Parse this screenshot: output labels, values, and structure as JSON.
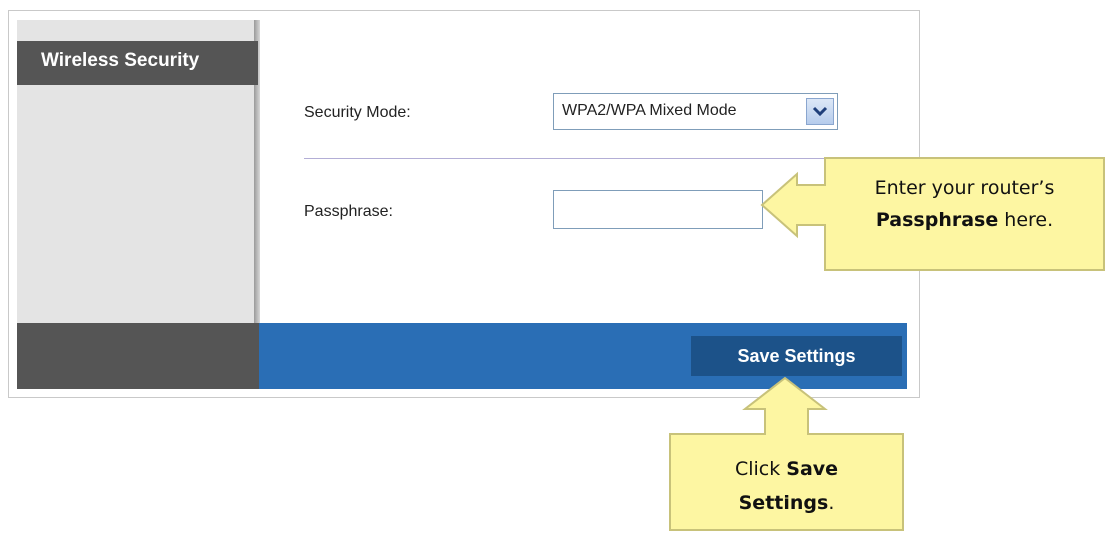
{
  "sidebar": {
    "title": "Wireless Security"
  },
  "form": {
    "security_mode_label": "Security Mode:",
    "security_mode_value": "WPA2/WPA Mixed Mode",
    "passphrase_label": "Passphrase:",
    "passphrase_value": ""
  },
  "footer": {
    "save_label": "Save Settings"
  },
  "callouts": {
    "passphrase": {
      "line1": "Enter your router’s",
      "bold": "Passphrase",
      "after": " here."
    },
    "save": {
      "before": "Click ",
      "bold1": "Save",
      "bold2": "Settings",
      "after": "."
    }
  },
  "colors": {
    "header_gray": "#555555",
    "sidebar_bg": "#e4e4e4",
    "footer_blue": "#2a6eb5",
    "button_blue": "#1c5289",
    "callout_fill": "#fdf6a2",
    "callout_stroke": "#c8c27a"
  },
  "icons": {
    "dropdown": "chevron-down-icon"
  }
}
